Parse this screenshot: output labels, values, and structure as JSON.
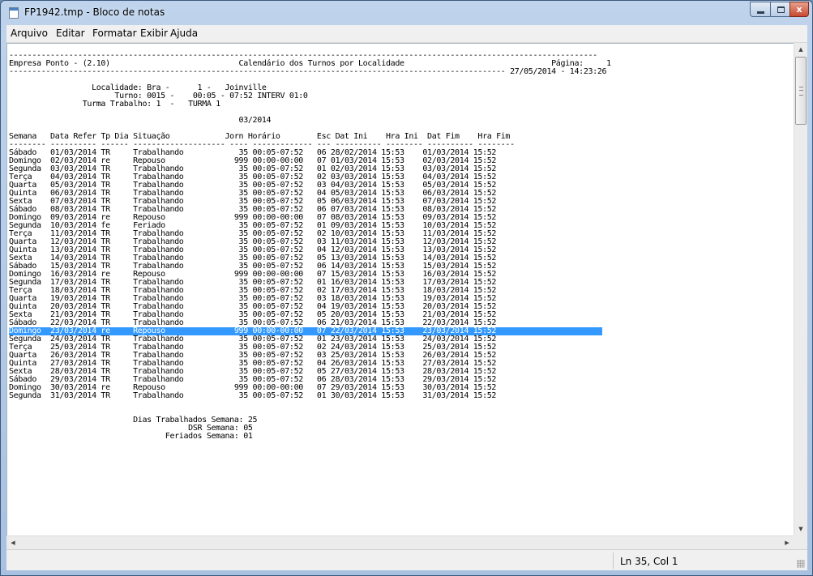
{
  "window": {
    "title": "FP1942.tmp - Bloco de notas",
    "controls": {
      "minimize": "minimize",
      "maximize": "maximize",
      "close": "x"
    }
  },
  "menu": [
    "Arquivo",
    "Editar",
    "Formatar",
    "Exibir",
    "Ajuda"
  ],
  "document": {
    "lines": [
      "--------------------------------------------------------------------------------------------------------------------------------",
      "Empresa Ponto - (2.10)                            Calendário dos Turnos por Localidade                                Página:     1",
      "------------------------------------------------------------------------------------------------------------ 27/05/2014 - 14:23:26",
      "",
      "                  Localidade: Bra -      1 -   Joinville",
      "                       Turno: 0015 -    00:05 - 07:52 INTERV 01:0",
      "                Turma Trabalho: 1  -   TURMA 1",
      "",
      "                                                  03/2014",
      "",
      "Semana   Data Refer Tp Dia Situação            Jorn Horário        Esc Dat Ini    Hra Ini  Dat Fim    Hra Fim",
      "-------- ---------- ------ -------------------- ---- ------------- --- ---------- -------- ---------- --------",
      "Sábado   01/03/2014 TR     Trabalhando            35 00:05-07:52   06 28/02/2014 15:53    01/03/2014 15:52",
      "Domingo  02/03/2014 re     Repouso               999 00:00-00:00   07 01/03/2014 15:53    02/03/2014 15:52",
      "Segunda  03/03/2014 TR     Trabalhando            35 00:05-07:52   01 02/03/2014 15:53    03/03/2014 15:52",
      "Terça    04/03/2014 TR     Trabalhando            35 00:05-07:52   02 03/03/2014 15:53    04/03/2014 15:52",
      "Quarta   05/03/2014 TR     Trabalhando            35 00:05-07:52   03 04/03/2014 15:53    05/03/2014 15:52",
      "Quinta   06/03/2014 TR     Trabalhando            35 00:05-07:52   04 05/03/2014 15:53    06/03/2014 15:52",
      "Sexta    07/03/2014 TR     Trabalhando            35 00:05-07:52   05 06/03/2014 15:53    07/03/2014 15:52",
      "Sábado   08/03/2014 TR     Trabalhando            35 00:05-07:52   06 07/03/2014 15:53    08/03/2014 15:52",
      "Domingo  09/03/2014 re     Repouso               999 00:00-00:00   07 08/03/2014 15:53    09/03/2014 15:52",
      "Segunda  10/03/2014 fe     Feriado                35 00:05-07:52   01 09/03/2014 15:53    10/03/2014 15:52",
      "Terça    11/03/2014 TR     Trabalhando            35 00:05-07:52   02 10/03/2014 15:53    11/03/2014 15:52",
      "Quarta   12/03/2014 TR     Trabalhando            35 00:05-07:52   03 11/03/2014 15:53    12/03/2014 15:52",
      "Quinta   13/03/2014 TR     Trabalhando            35 00:05-07:52   04 12/03/2014 15:53    13/03/2014 15:52",
      "Sexta    14/03/2014 TR     Trabalhando            35 00:05-07:52   05 13/03/2014 15:53    14/03/2014 15:52",
      "Sábado   15/03/2014 TR     Trabalhando            35 00:05-07:52   06 14/03/2014 15:53    15/03/2014 15:52",
      "Domingo  16/03/2014 re     Repouso               999 00:00-00:00   07 15/03/2014 15:53    16/03/2014 15:52",
      "Segunda  17/03/2014 TR     Trabalhando            35 00:05-07:52   01 16/03/2014 15:53    17/03/2014 15:52",
      "Terça    18/03/2014 TR     Trabalhando            35 00:05-07:52   02 17/03/2014 15:53    18/03/2014 15:52",
      "Quarta   19/03/2014 TR     Trabalhando            35 00:05-07:52   03 18/03/2014 15:53    19/03/2014 15:52",
      "Quinta   20/03/2014 TR     Trabalhando            35 00:05-07:52   04 19/03/2014 15:53    20/03/2014 15:52",
      "Sexta    21/03/2014 TR     Trabalhando            35 00:05-07:52   05 20/03/2014 15:53    21/03/2014 15:52",
      "Sábado   22/03/2014 TR     Trabalhando            35 00:05-07:52   06 21/03/2014 15:53    22/03/2014 15:52",
      "Domingo  23/03/2014 re     Repouso               999 00:00-00:00   07 22/03/2014 15:53    23/03/2014 15:52",
      "Segunda  24/03/2014 TR     Trabalhando            35 00:05-07:52   01 23/03/2014 15:53    24/03/2014 15:52",
      "Terça    25/03/2014 TR     Trabalhando            35 00:05-07:52   02 24/03/2014 15:53    25/03/2014 15:52",
      "Quarta   26/03/2014 TR     Trabalhando            35 00:05-07:52   03 25/03/2014 15:53    26/03/2014 15:52",
      "Quinta   27/03/2014 TR     Trabalhando            35 00:05-07:52   04 26/03/2014 15:53    27/03/2014 15:52",
      "Sexta    28/03/2014 TR     Trabalhando            35 00:05-07:52   05 27/03/2014 15:53    28/03/2014 15:52",
      "Sábado   29/03/2014 TR     Trabalhando            35 00:05-07:52   06 28/03/2014 15:53    29/03/2014 15:52",
      "Domingo  30/03/2014 re     Repouso               999 00:00-00:00   07 29/03/2014 15:53    30/03/2014 15:52",
      "Segunda  31/03/2014 TR     Trabalhando            35 00:05-07:52   01 30/03/2014 15:53    31/03/2014 15:52",
      "",
      "",
      "                           Dias Trabalhados Semana: 25",
      "                                       DSR Semana: 05",
      "                                  Feriados Semana: 01"
    ],
    "selected_line": 34
  },
  "statusbar": {
    "position": "Ln 35, Col 1"
  }
}
